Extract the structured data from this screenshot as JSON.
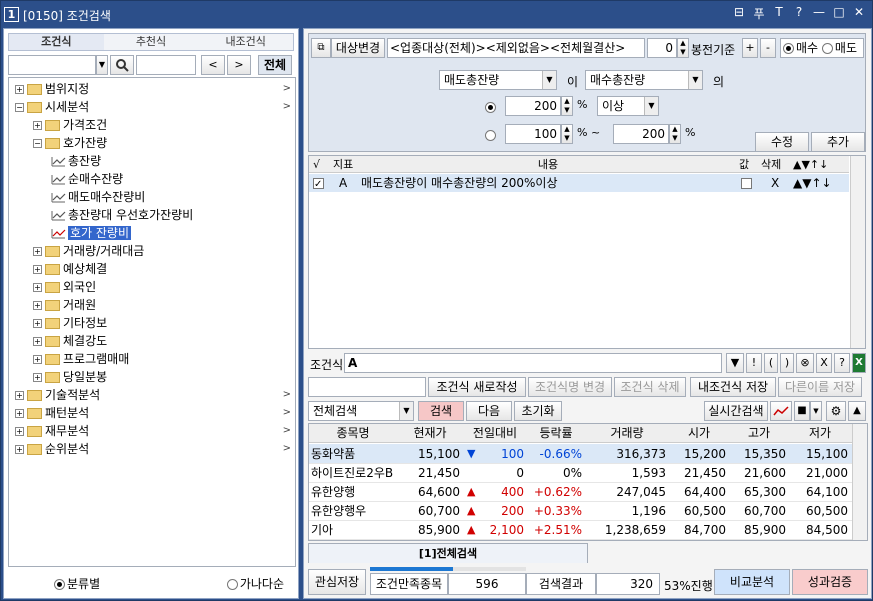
{
  "window": {
    "num": "1",
    "title": "[0150] 조건검색"
  },
  "titlebar_icons": [
    "⊟",
    "푸",
    "T",
    "?",
    "—",
    "□",
    "✕"
  ],
  "left": {
    "tabs": [
      {
        "label": "조건식",
        "active": true
      },
      {
        "label": "추천식",
        "active": false
      },
      {
        "label": "내조건식",
        "active": false
      }
    ],
    "search": {
      "prev": "<",
      "next": ">",
      "all": "전체"
    },
    "tree": [
      {
        "label": "범위지정",
        "level": 0,
        "pm": "+",
        "type": "folder",
        "arrow": ">"
      },
      {
        "label": "시세분석",
        "level": 0,
        "pm": "−",
        "type": "folder",
        "arrow": ">"
      },
      {
        "label": "가격조건",
        "level": 1,
        "pm": "+",
        "type": "folder",
        "arrow": ""
      },
      {
        "label": "호가잔량",
        "level": 1,
        "pm": "−",
        "type": "folder",
        "arrow": ""
      },
      {
        "label": "총잔량",
        "level": 2,
        "pm": "",
        "type": "leaf",
        "arrow": ""
      },
      {
        "label": "순매수잔량",
        "level": 2,
        "pm": "",
        "type": "leaf",
        "arrow": ""
      },
      {
        "label": "매도매수잔량비",
        "level": 2,
        "pm": "",
        "type": "leaf",
        "arrow": ""
      },
      {
        "label": "총잔량대 우선호가잔량비",
        "level": 2,
        "pm": "",
        "type": "leaf",
        "arrow": ""
      },
      {
        "label": "호가 잔량비",
        "level": 2,
        "pm": "",
        "type": "leaf",
        "arrow": "",
        "selected": true
      },
      {
        "label": "거래량/거래대금",
        "level": 1,
        "pm": "+",
        "type": "folder",
        "arrow": ""
      },
      {
        "label": "예상체결",
        "level": 1,
        "pm": "+",
        "type": "folder",
        "arrow": ""
      },
      {
        "label": "외국인",
        "level": 1,
        "pm": "+",
        "type": "folder",
        "arrow": ""
      },
      {
        "label": "거래원",
        "level": 1,
        "pm": "+",
        "type": "folder",
        "arrow": ""
      },
      {
        "label": "기타정보",
        "level": 1,
        "pm": "+",
        "type": "folder",
        "arrow": ""
      },
      {
        "label": "체결강도",
        "level": 1,
        "pm": "+",
        "type": "folder",
        "arrow": ""
      },
      {
        "label": "프로그램매매",
        "level": 1,
        "pm": "+",
        "type": "folder",
        "arrow": ""
      },
      {
        "label": "당일분봉",
        "level": 1,
        "pm": "+",
        "type": "folder",
        "arrow": ""
      },
      {
        "label": "기술적분석",
        "level": 0,
        "pm": "+",
        "type": "folder",
        "arrow": ">"
      },
      {
        "label": "패턴분석",
        "level": 0,
        "pm": "+",
        "type": "folder",
        "arrow": ">"
      },
      {
        "label": "재무분석",
        "level": 0,
        "pm": "+",
        "type": "folder",
        "arrow": ">"
      },
      {
        "label": "순위분석",
        "level": 0,
        "pm": "+",
        "type": "folder",
        "arrow": ">"
      }
    ],
    "sort": {
      "by_category": "분류별",
      "by_name": "가나다순"
    }
  },
  "cond": {
    "target_btn": "대상변경",
    "target_text": "<업종대상(전체)><제외없음><전체월결산>",
    "bong_value": "0",
    "bong_label": "봉전기준",
    "plus": "+",
    "minus": "-",
    "buy": "매수",
    "sell": "매도",
    "field1": "매도총잔량",
    "i_label": "이",
    "field2": "매수총잔량",
    "ui_label": "의",
    "val1": "200",
    "pct1": "%",
    "op1": "이상",
    "val2": "100",
    "pct2": "%",
    "tilde": "~",
    "val3": "200",
    "pct3": "%",
    "edit_btn": "수정",
    "add_btn": "추가"
  },
  "cond_grid": {
    "headers": {
      "check": "√",
      "index": "지표",
      "content": "내용",
      "value": "값",
      "delete": "삭제",
      "move": "▲▼↑↓"
    },
    "rows": [
      {
        "index": "A",
        "content": "매도총잔량이 매수총잔량의 200%이상",
        "delete": "X",
        "move": "▲▼↑↓"
      }
    ]
  },
  "formula": {
    "label": "조건식",
    "value": "A",
    "ops": [
      "▼",
      "!",
      "(",
      ")",
      "⊗",
      "X",
      "?"
    ]
  },
  "actions": {
    "new": "조건식 새로작성",
    "rename": "조건식명 변경",
    "delete": "조건식 삭제",
    "save_my": "내조건식 저장",
    "save_as": "다른이름 저장"
  },
  "search": {
    "scope": "전체검색",
    "search_btn": "검색",
    "next_btn": "다음",
    "reset_btn": "초기화",
    "realtime_btn": "실시간검색"
  },
  "results": {
    "headers": [
      "종목명",
      "현재가",
      "전일대비",
      "등락률",
      "거래량",
      "시가",
      "고가",
      "저가"
    ],
    "rows": [
      {
        "name": "동화약품",
        "price": "15,100",
        "dir": "down",
        "change": "100",
        "rate": "-0.66%",
        "volume": "316,373",
        "open": "15,200",
        "high": "15,350",
        "low": "15,100"
      },
      {
        "name": "하이트진로2우B",
        "price": "21,450",
        "dir": "none",
        "change": "0",
        "rate": "0%",
        "volume": "1,593",
        "open": "21,450",
        "high": "21,600",
        "low": "21,000"
      },
      {
        "name": "유한양행",
        "price": "64,600",
        "dir": "up",
        "change": "400",
        "rate": "+0.62%",
        "volume": "247,045",
        "open": "64,400",
        "high": "65,300",
        "low": "64,100"
      },
      {
        "name": "유한양행우",
        "price": "60,700",
        "dir": "up",
        "change": "200",
        "rate": "+0.33%",
        "volume": "1,196",
        "open": "60,500",
        "high": "60,700",
        "low": "60,500"
      },
      {
        "name": "기아",
        "price": "85,900",
        "dir": "up",
        "change": "2,100",
        "rate": "+2.51%",
        "volume": "1,238,659",
        "open": "84,700",
        "high": "85,900",
        "low": "84,500"
      }
    ],
    "tab": "[1]전체검색"
  },
  "status": {
    "save_interest": "관심저장",
    "match_label": "조건만족종목",
    "match_count": "596",
    "result_label": "검색결과",
    "result_count": "320",
    "progress": "53%진행",
    "progress_value": 0.53,
    "compare": "비교분석",
    "verify": "성과검증"
  },
  "colors": {
    "titlebar": "#2c4f8a",
    "up": "#d10000",
    "down": "#0044d6",
    "search_btn": "#f6c7c7",
    "compare": "#cfe3fb",
    "verify": "#f9cccc"
  }
}
